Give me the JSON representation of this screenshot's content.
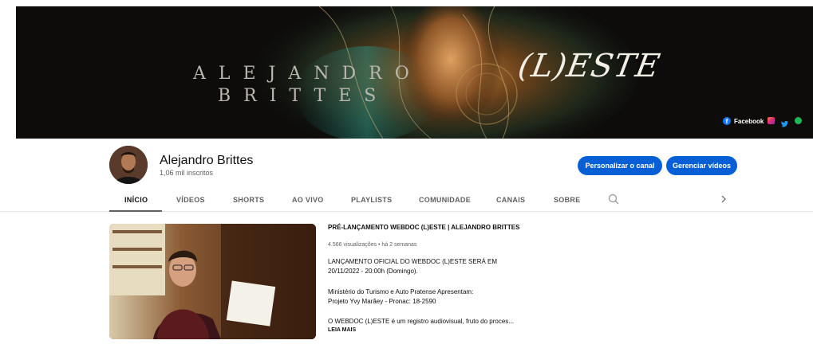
{
  "banner": {
    "name_line1": "ALEJANDRO",
    "name_line2": "BRITTES",
    "title": "(L)ESTE",
    "social_facebook": "Facebook",
    "social_icons": [
      "instagram-icon",
      "twitter-icon",
      "spotify-icon"
    ]
  },
  "channel": {
    "name": "Alejandro Brittes",
    "subscribers": "1,06 mil inscritos",
    "customize_label": "Personalizar o canal",
    "manage_label": "Gerenciar vídeos"
  },
  "tabs": [
    "INÍCIO",
    "VÍDEOS",
    "SHORTS",
    "AO VIVO",
    "PLAYLISTS",
    "COMUNIDADE",
    "CANAIS",
    "SOBRE"
  ],
  "active_tab": "INÍCIO",
  "featured": {
    "title": "PRÉ-LANÇAMENTO WEBDOC (L)ESTE | ALEJANDRO BRITTES",
    "meta": "4.566 visualizações • há 2 semanas",
    "desc_line1": "LANÇAMENTO OFICIAL DO WEBDOC (L)ESTE SERÁ EM",
    "desc_line2": "20/11/2022 - 20:00h (Domingo).",
    "desc_line3": "Ministério do Turismo e Auto Pratense Apresentam:",
    "desc_line4": "Projeto Yvy Marãey - Pronac: 18-2590",
    "desc_line5": "O WEBDOC (L)ESTE é um registro audiovisual, fruto do proces...",
    "read_more": "LEIA MAIS"
  },
  "colors": {
    "accent": "#065fd4",
    "text_primary": "#0f0f0f",
    "text_secondary": "#606060",
    "banner_bg": "#0d0c0b"
  }
}
